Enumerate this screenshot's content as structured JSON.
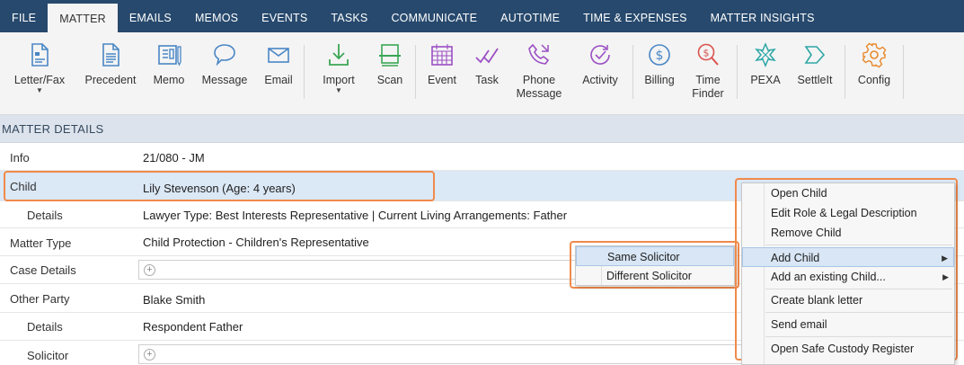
{
  "tabs": [
    "FILE",
    "MATTER",
    "EMAILS",
    "MEMOS",
    "EVENTS",
    "TASKS",
    "COMMUNICATE",
    "AUTOTIME",
    "TIME & EXPENSES",
    "MATTER INSIGHTS"
  ],
  "active_tab": "MATTER",
  "ribbon": {
    "letter_fax": "Letter/Fax",
    "precedent": "Precedent",
    "memo": "Memo",
    "message": "Message",
    "email": "Email",
    "import": "Import",
    "scan": "Scan",
    "event": "Event",
    "task": "Task",
    "phone_line1": "Phone",
    "phone_line2": "Message",
    "activity": "Activity",
    "billing": "Billing",
    "time_line1": "Time",
    "time_line2": "Finder",
    "pexa": "PEXA",
    "settleit": "SettleIt",
    "config": "Config"
  },
  "section_title": "MATTER DETAILS",
  "rows": {
    "info": {
      "label": "Info",
      "value": "21/080 - JM"
    },
    "child": {
      "label": "Child",
      "value": "Lily Stevenson (Age: 4 years)"
    },
    "child_details": {
      "label": "Details",
      "value": "Lawyer Type: Best Interests Representative | Current Living Arrangements: Father"
    },
    "matter_type": {
      "label": "Matter Type",
      "value": "Child Protection - Children's Representative"
    },
    "case_details": {
      "label": "Case Details",
      "value": ""
    },
    "other_party": {
      "label": "Other Party",
      "value": "Blake Smith"
    },
    "party_details": {
      "label": "Details",
      "value": "Respondent Father"
    },
    "solicitor": {
      "label": "Solicitor",
      "value": ""
    }
  },
  "context_menu": {
    "open_child": "Open Child",
    "edit_role": "Edit Role & Legal Description",
    "remove_child": "Remove Child",
    "add_child": "Add Child",
    "add_existing": "Add an existing Child...",
    "create_letter": "Create blank letter",
    "send_email": "Send email",
    "open_safe": "Open Safe Custody Register"
  },
  "submenu": {
    "same": "Same Solicitor",
    "different": "Different Solicitor"
  },
  "colors": {
    "tabbar": "#27496d",
    "highlight": "#f08a4b",
    "selected_row": "#dbe8f6",
    "icon_blue": "#4a86c5",
    "icon_green": "#3aa655",
    "icon_purple": "#9b4fc4",
    "icon_red": "#d9534f",
    "icon_teal": "#2ea6a6",
    "icon_orange": "#e8892b"
  }
}
